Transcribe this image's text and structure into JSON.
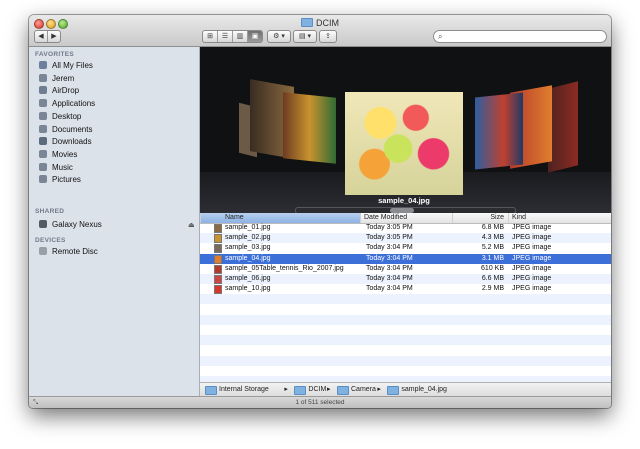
{
  "window": {
    "title": "DCIM"
  },
  "toolbar": {
    "nav_back": "◀",
    "nav_forward": "▶",
    "view_icons": "⊞",
    "view_list": "☰",
    "view_columns": "▥",
    "view_coverflow": "▣",
    "action_menu": "⚙ ▾",
    "arrange_menu": "▤ ▾",
    "share": "⇪",
    "search_icon": "🔍",
    "search_value": ""
  },
  "sidebar": {
    "favorites_header": "FAVORITES",
    "favorites": [
      {
        "label": "All My Files",
        "icon": "all-files-icon",
        "color": "#6d7f9b"
      },
      {
        "label": "Jerem",
        "icon": "home-icon",
        "color": "#7a8596"
      },
      {
        "label": "AirDrop",
        "icon": "airdrop-icon",
        "color": "#6f7d92"
      },
      {
        "label": "Applications",
        "icon": "applications-icon",
        "color": "#7a8596"
      },
      {
        "label": "Desktop",
        "icon": "desktop-icon",
        "color": "#7a8596"
      },
      {
        "label": "Documents",
        "icon": "documents-icon",
        "color": "#7a8596"
      },
      {
        "label": "Downloads",
        "icon": "downloads-icon",
        "color": "#5d6b7f"
      },
      {
        "label": "Movies",
        "icon": "movies-icon",
        "color": "#7a8596"
      },
      {
        "label": "Music",
        "icon": "music-icon",
        "color": "#7a8596"
      },
      {
        "label": "Pictures",
        "icon": "pictures-icon",
        "color": "#7a8596"
      }
    ],
    "shared_header": "SHARED",
    "shared": [
      {
        "label": "Galaxy Nexus",
        "icon": "phone-icon",
        "color": "#555b63"
      }
    ],
    "eject_icon": "⏏",
    "devices_header": "DEVICES",
    "devices": [
      {
        "label": "Remote Disc",
        "icon": "disc-icon",
        "color": "#9aa0a8"
      }
    ]
  },
  "coverflow": {
    "caption": "sample_04.jpg"
  },
  "columns": {
    "name": "Name",
    "date": "Date Modified",
    "size": "Size",
    "kind": "Kind"
  },
  "files": [
    {
      "name": "sample_01.jpg",
      "date": "Today 3:05 PM",
      "size": "6.8 MB",
      "kind": "JPEG image"
    },
    {
      "name": "sample_02.jpg",
      "date": "Today 3:05 PM",
      "size": "4.3 MB",
      "kind": "JPEG image"
    },
    {
      "name": "sample_03.jpg",
      "date": "Today 3:04 PM",
      "size": "5.2 MB",
      "kind": "JPEG image"
    },
    {
      "name": "sample_04.jpg",
      "date": "Today 3:04 PM",
      "size": "3.1 MB",
      "kind": "JPEG image"
    },
    {
      "name": "sample_05Table_tennis_Rio_2007.jpg",
      "date": "Today 3:04 PM",
      "size": "610 KB",
      "kind": "JPEG image"
    },
    {
      "name": "sample_06.jpg",
      "date": "Today 3:04 PM",
      "size": "6.6 MB",
      "kind": "JPEG image"
    },
    {
      "name": "sample_10.jpg",
      "date": "Today 3:04 PM",
      "size": "2.9 MB",
      "kind": "JPEG image"
    }
  ],
  "selected_file": "sample_04.jpg",
  "pathbar": [
    {
      "label": "Internal Storage"
    },
    {
      "label": "DCIM"
    },
    {
      "label": "Camera"
    },
    {
      "label": "sample_04.jpg"
    }
  ],
  "pathbar_separator": "▸",
  "status": {
    "text": "1 of 511 selected",
    "resize_icon": "⤡"
  },
  "colors": {
    "selection": "#3d6fd8",
    "sidebar_bg": "#dce2ea",
    "alt_row": "#edf3fe"
  }
}
